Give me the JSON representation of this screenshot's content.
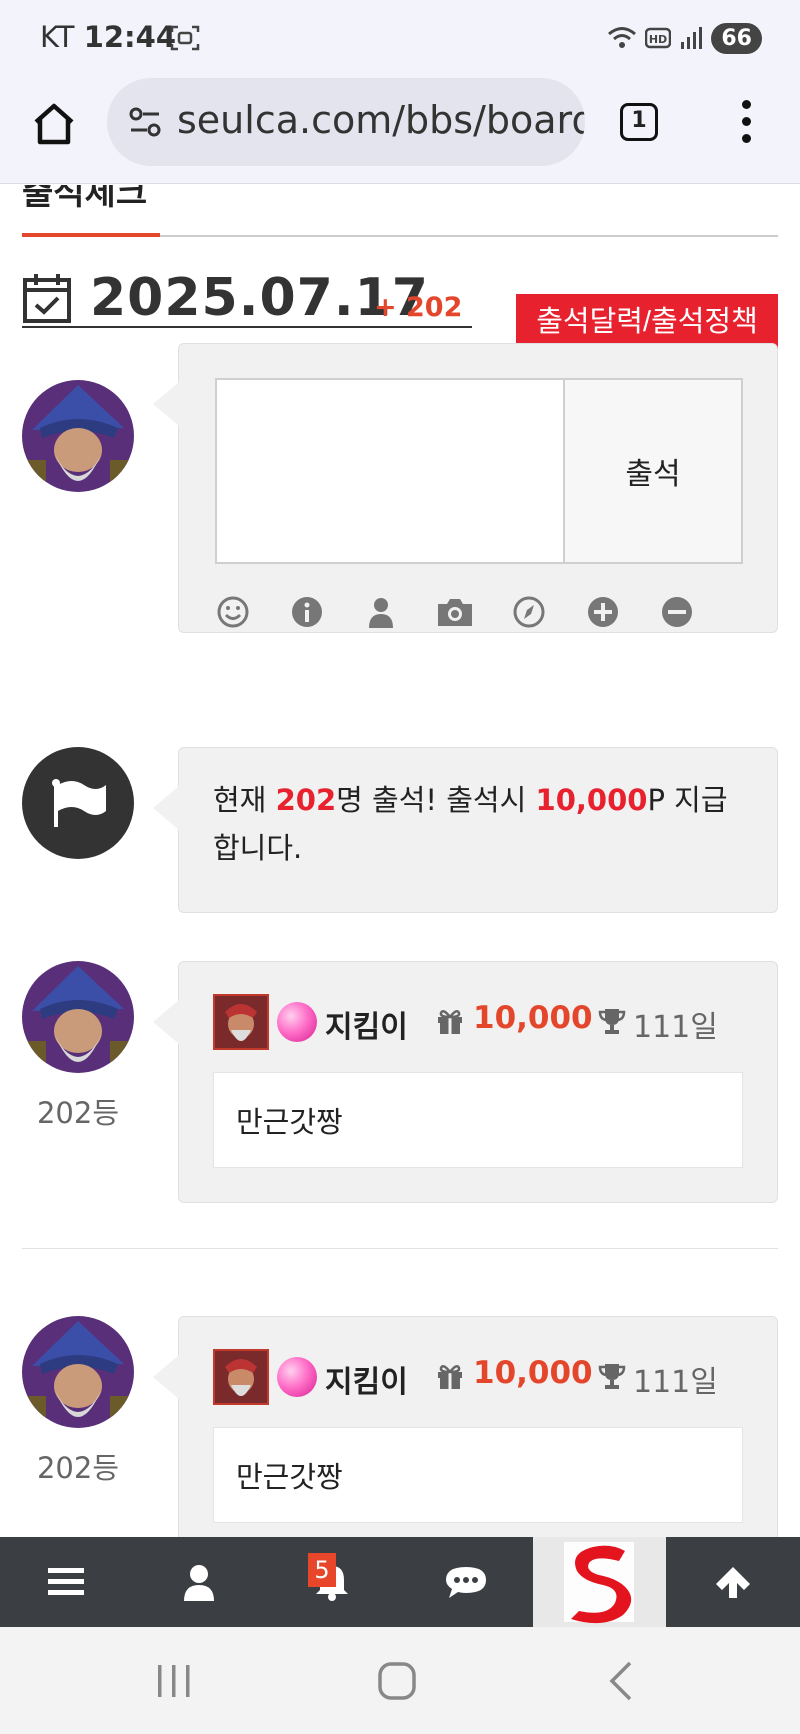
{
  "status_bar": {
    "carrier": "KT",
    "time": "12:44",
    "battery": "66"
  },
  "browser": {
    "url": "seulca.com/bbs/board",
    "tab_count": "1"
  },
  "page": {
    "section_title": "출석체크",
    "date": "2025.07.17",
    "attendance_increment": "+ 202",
    "calendar_button": "출석달력/출석정책",
    "attend_button": "출석",
    "tools": [
      "smile-icon",
      "info-icon",
      "user-icon",
      "camera-icon",
      "compass-icon",
      "plus-icon",
      "minus-icon"
    ],
    "notice": {
      "prefix": "현재 ",
      "count": "202",
      "middle": "명 출석! 출석시 ",
      "points": "10,000",
      "suffix": "P 지급합니다."
    },
    "entries": [
      {
        "rank": "202등",
        "nickname": "지킴이",
        "points": "10,000",
        "days": "111일",
        "comment": "만근갓짱"
      },
      {
        "rank": "202등",
        "nickname": "지킴이",
        "points": "10,000",
        "days": "111일",
        "comment": "만근갓짱"
      }
    ]
  },
  "bottom_bar": {
    "notification_badge": "5"
  },
  "colors": {
    "accent_red": "#e8212f",
    "points_orange": "#e4462c",
    "toolbar_bg": "#3b3f44"
  }
}
